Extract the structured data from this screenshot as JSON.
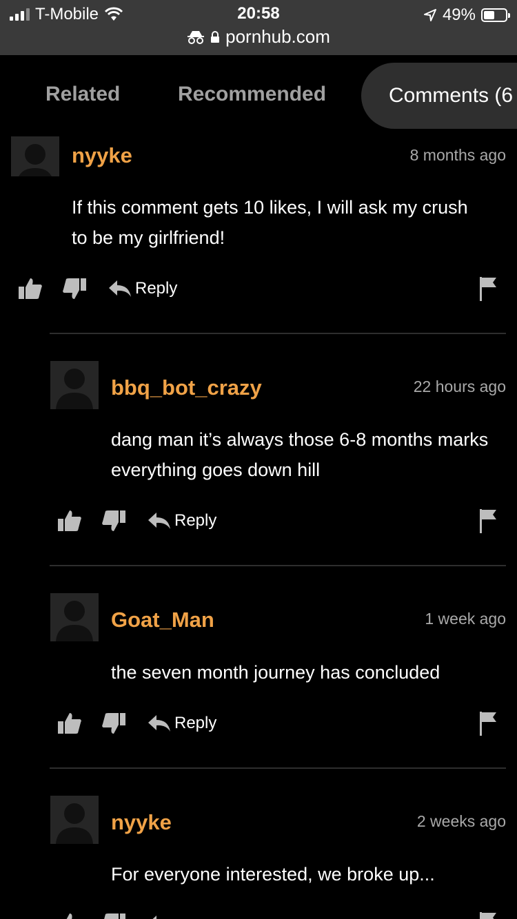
{
  "status": {
    "carrier": "T-Mobile",
    "time": "20:58",
    "battery": "49%",
    "battery_level": 0.49,
    "url": "pornhub.com"
  },
  "tabs": [
    {
      "label": "Related"
    },
    {
      "label": "Recommended"
    },
    {
      "label": "Comments (6"
    }
  ],
  "actions": {
    "reply": "Reply"
  },
  "comments": [
    {
      "username": "nyyke",
      "time": "8 months ago",
      "text": "If this comment gets 10 likes, I will ask my crush to be my girlfriend!"
    },
    {
      "username": "bbq_bot_crazy",
      "time": "22 hours ago",
      "text": "dang man it’s always those 6-8 months marks everything goes down hill"
    },
    {
      "username": "Goat_Man",
      "time": "1 week ago",
      "text": "the seven month journey has concluded"
    },
    {
      "username": "nyyke",
      "time": "2 weeks ago",
      "text": "For everyone interested, we broke up..."
    }
  ]
}
